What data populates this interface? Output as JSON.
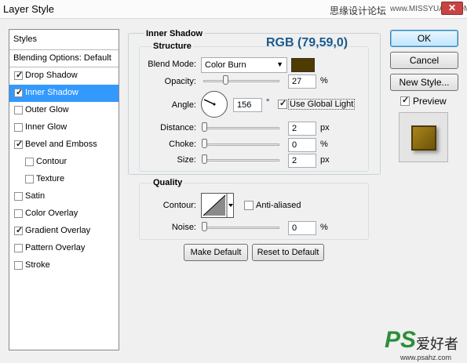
{
  "window": {
    "title": "Layer Style",
    "watermark_cn": "思缘设计论坛",
    "watermark_url": "www.MISSYUAN.COM"
  },
  "styles_panel": {
    "header": "Styles",
    "blending_options": "Blending Options: Default",
    "items": [
      {
        "label": "Drop Shadow",
        "checked": true,
        "selected": false,
        "indent": false
      },
      {
        "label": "Inner Shadow",
        "checked": true,
        "selected": true,
        "indent": false
      },
      {
        "label": "Outer Glow",
        "checked": false,
        "selected": false,
        "indent": false
      },
      {
        "label": "Inner Glow",
        "checked": false,
        "selected": false,
        "indent": false
      },
      {
        "label": "Bevel and Emboss",
        "checked": true,
        "selected": false,
        "indent": false
      },
      {
        "label": "Contour",
        "checked": false,
        "selected": false,
        "indent": true
      },
      {
        "label": "Texture",
        "checked": false,
        "selected": false,
        "indent": true
      },
      {
        "label": "Satin",
        "checked": false,
        "selected": false,
        "indent": false
      },
      {
        "label": "Color Overlay",
        "checked": false,
        "selected": false,
        "indent": false
      },
      {
        "label": "Gradient Overlay",
        "checked": true,
        "selected": false,
        "indent": false
      },
      {
        "label": "Pattern Overlay",
        "checked": false,
        "selected": false,
        "indent": false
      },
      {
        "label": "Stroke",
        "checked": false,
        "selected": false,
        "indent": false
      }
    ]
  },
  "inner_shadow": {
    "title": "Inner Shadow",
    "structure_label": "Structure",
    "rgb_note": "RGB (79,59,0)",
    "blend_mode_label": "Blend Mode:",
    "blend_mode_value": "Color Burn",
    "shadow_color": "#4f3b00",
    "opacity_label": "Opacity:",
    "opacity_value": "27",
    "opacity_unit": "%",
    "angle_label": "Angle:",
    "angle_value": "156",
    "angle_unit": "°",
    "use_global_light_label": "Use Global Light",
    "use_global_light": true,
    "distance_label": "Distance:",
    "distance_value": "2",
    "distance_unit": "px",
    "choke_label": "Choke:",
    "choke_value": "0",
    "choke_unit": "%",
    "size_label": "Size:",
    "size_value": "2",
    "size_unit": "px",
    "quality_label": "Quality",
    "contour_label": "Contour:",
    "anti_aliased_label": "Anti-aliased",
    "anti_aliased": false,
    "noise_label": "Noise:",
    "noise_value": "0",
    "noise_unit": "%",
    "make_default_label": "Make Default",
    "reset_default_label": "Reset to Default"
  },
  "right_panel": {
    "ok_label": "OK",
    "cancel_label": "Cancel",
    "new_style_label": "New Style...",
    "preview_label": "Preview",
    "preview_checked": true
  },
  "logo": {
    "ps": "PS",
    "cn": "爱好者",
    "url": "www.psahz.com"
  }
}
